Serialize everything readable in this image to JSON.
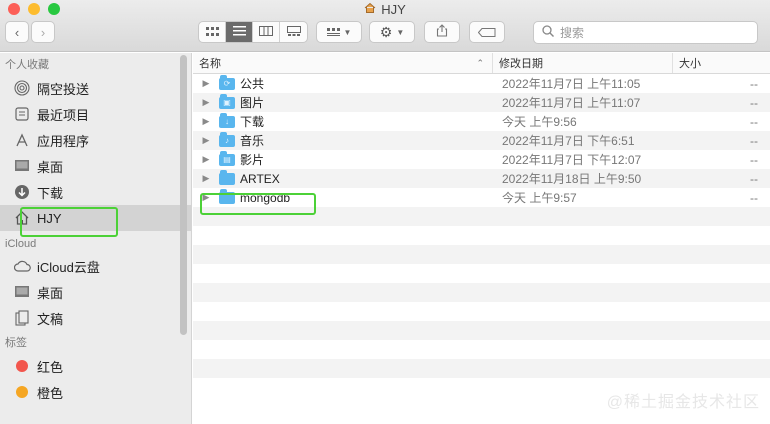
{
  "window": {
    "title": "HJY"
  },
  "toolbar": {
    "search_placeholder": "搜索"
  },
  "sidebar": {
    "favorites_header": "个人收藏",
    "favorites": [
      {
        "label": "隔空投送",
        "icon": "airdrop-icon"
      },
      {
        "label": "最近项目",
        "icon": "recents-icon"
      },
      {
        "label": "应用程序",
        "icon": "applications-icon"
      },
      {
        "label": "桌面",
        "icon": "desktop-icon"
      },
      {
        "label": "下载",
        "icon": "downloads-icon"
      },
      {
        "label": "HJY",
        "icon": "home-icon"
      }
    ],
    "icloud_header": "iCloud",
    "icloud": [
      {
        "label": "iCloud云盘",
        "icon": "cloud-icon"
      },
      {
        "label": "桌面",
        "icon": "desktop-icon"
      },
      {
        "label": "文稿",
        "icon": "documents-icon"
      }
    ],
    "tags_header": "标签",
    "tags": [
      {
        "label": "红色",
        "color": "#f2564d"
      },
      {
        "label": "橙色",
        "color": "#f5a623"
      }
    ]
  },
  "columns": {
    "name": "名称",
    "date": "修改日期",
    "size": "大小"
  },
  "files": [
    {
      "name": "公共",
      "date": "2022年11月7日 上午11:05",
      "size": "--"
    },
    {
      "name": "图片",
      "date": "2022年11月7日 上午11:07",
      "size": "--"
    },
    {
      "name": "下载",
      "date": "今天 上午9:56",
      "size": "--"
    },
    {
      "name": "音乐",
      "date": "2022年11月7日 下午6:51",
      "size": "--"
    },
    {
      "name": "影片",
      "date": "2022年11月7日 下午12:07",
      "size": "--"
    },
    {
      "name": "ARTEX",
      "date": "2022年11月18日 上午9:50",
      "size": "--"
    },
    {
      "name": "mongodb",
      "date": "今天 上午9:57",
      "size": "--"
    }
  ],
  "watermark": "@稀土掘金技术社区"
}
